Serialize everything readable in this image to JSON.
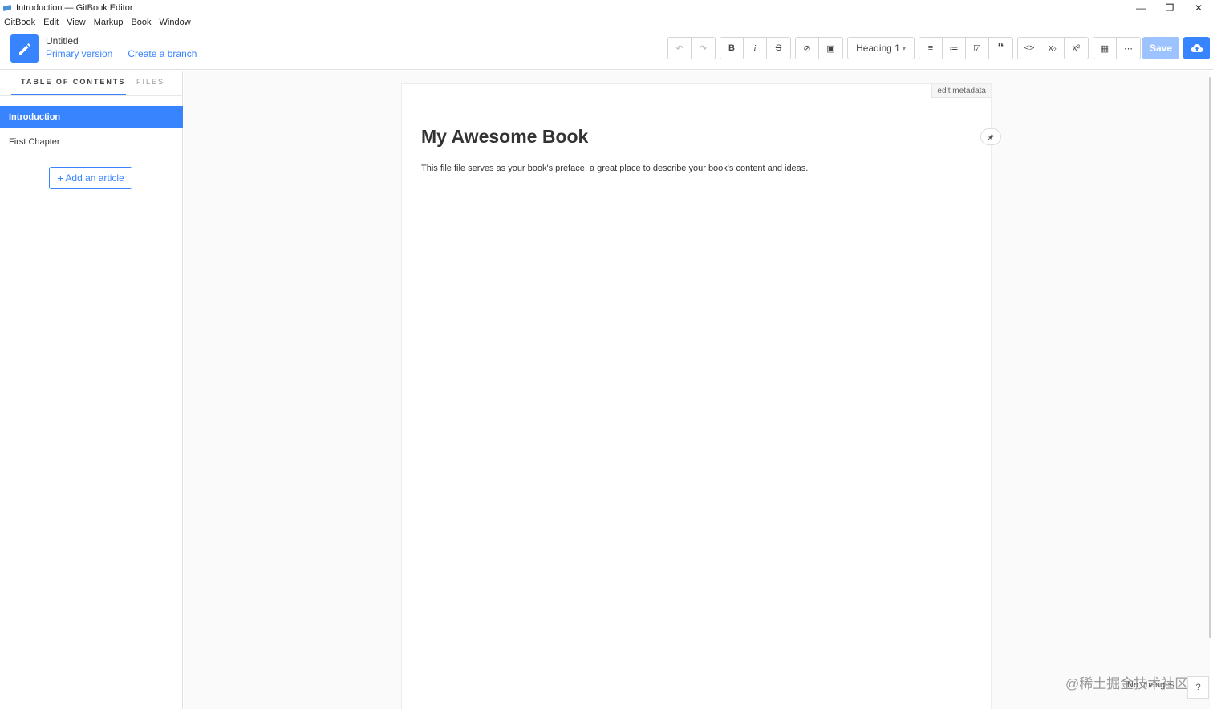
{
  "window": {
    "title": "Introduction — GitBook Editor",
    "minimize": "—",
    "restore": "❐",
    "close": "✕"
  },
  "menu": [
    "GitBook",
    "Edit",
    "View",
    "Markup",
    "Book",
    "Window"
  ],
  "header": {
    "book_title": "Untitled",
    "primary_version": "Primary version",
    "create_branch": "Create a branch",
    "save_label": "Save"
  },
  "toolbar": {
    "undo": "↶",
    "redo": "↷",
    "bold": "B",
    "italic": "i",
    "strike": "S",
    "link": "⊘",
    "image": "▣",
    "heading": "Heading 1",
    "bullet_list": "≡",
    "numbered_list": "≔",
    "task_list": "☑",
    "quote": "“",
    "code": "<>",
    "subscript": "x₂",
    "superscript": "x²",
    "table": "▦",
    "more": "⋯"
  },
  "sidebar": {
    "tabs": [
      "TABLE OF CONTENTS",
      "FILES"
    ],
    "items": [
      {
        "label": "Introduction",
        "active": true
      },
      {
        "label": "First Chapter",
        "active": false
      }
    ],
    "add_article": "Add an article"
  },
  "editor": {
    "edit_metadata": "edit metadata",
    "title": "My Awesome Book",
    "body": "This file file serves as your book's preface, a great place to describe your book's content and ideas."
  },
  "status": {
    "text": "No changes",
    "help": "?",
    "watermark": "@稀土掘金技术社区"
  },
  "colors": {
    "accent": "#3884ff"
  }
}
